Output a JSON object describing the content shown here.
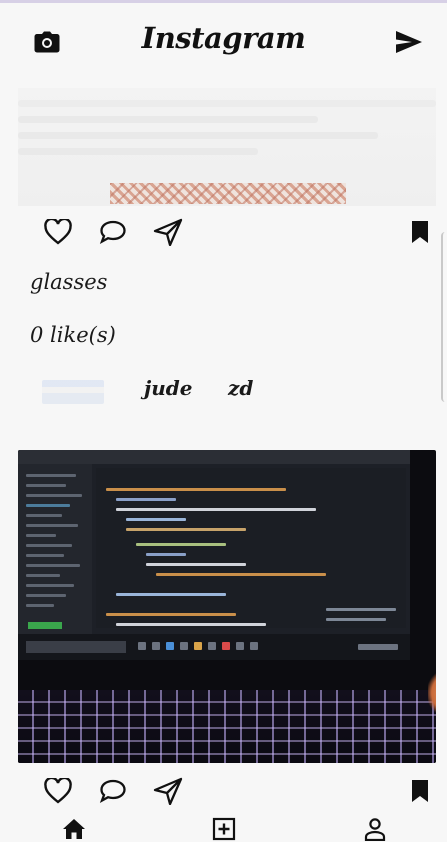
{
  "header": {
    "title": "Instagram",
    "camera_icon": "camera-icon",
    "send_icon": "send-icon"
  },
  "posts": [
    {
      "caption": "glasses",
      "likes": "0 like(s)",
      "user": {
        "name": "jude",
        "handle": "zd"
      },
      "icons": [
        "heart-icon",
        "comment-icon",
        "share-icon",
        "bookmark-icon"
      ]
    },
    {
      "icons": [
        "heart-icon",
        "comment-icon",
        "share-icon",
        "bookmark-icon"
      ]
    }
  ],
  "bottom_nav": {
    "items": [
      "home-icon",
      "add-post-icon",
      "profile-icon"
    ]
  },
  "colors": {
    "background": "#f7f7f7",
    "icon": "#111111"
  }
}
